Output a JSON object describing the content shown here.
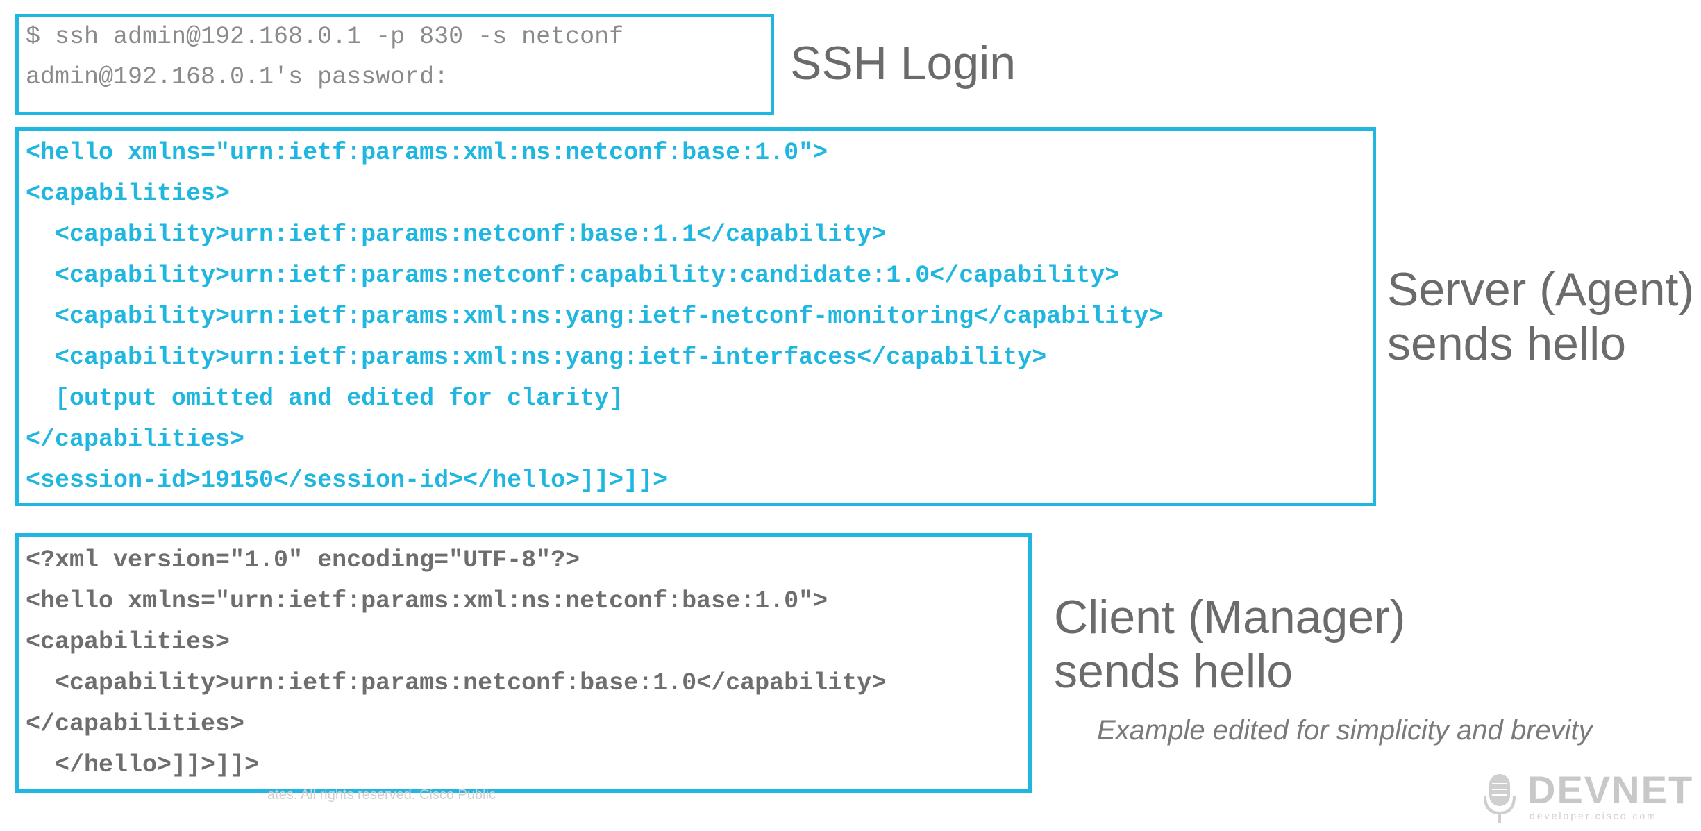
{
  "ssh": {
    "label": "SSH Login",
    "lines": [
      "$ ssh admin@192.168.0.1 -p 830 -s netconf",
      "admin@192.168.0.1's password:"
    ]
  },
  "server": {
    "label_line1": "Server (Agent)",
    "label_line2": "sends hello",
    "lines": [
      "<hello xmlns=\"urn:ietf:params:xml:ns:netconf:base:1.0\">",
      "<capabilities>",
      "  <capability>urn:ietf:params:netconf:base:1.1</capability>",
      "  <capability>urn:ietf:params:netconf:capability:candidate:1.0</capability>",
      "  <capability>urn:ietf:params:xml:ns:yang:ietf-netconf-monitoring</capability>",
      "  <capability>urn:ietf:params:xml:ns:yang:ietf-interfaces</capability>",
      "  [output omitted and edited for clarity]",
      "</capabilities>",
      "<session-id>19150</session-id></hello>]]>]]>"
    ]
  },
  "client": {
    "label_line1": "Client (Manager)",
    "label_line2": "sends hello",
    "lines": [
      "<?xml version=\"1.0\" encoding=\"UTF-8\"?>",
      "<hello xmlns=\"urn:ietf:params:xml:ns:netconf:base:1.0\">",
      "<capabilities>",
      "  <capability>urn:ietf:params:netconf:base:1.0</capability>",
      "</capabilities>",
      "  </hello>]]>]]>"
    ]
  },
  "note": "Example edited for simplicity and brevity",
  "footer": "ates. All rights reserved.   Cisco Public",
  "logo": {
    "word": "DEVNET",
    "url": "developer.cisco.com",
    "icon": "microphone-icon"
  },
  "colors": {
    "accent": "#1fb6e0",
    "label_text": "#6b6b6b",
    "client_code": "#6e6e6e"
  }
}
